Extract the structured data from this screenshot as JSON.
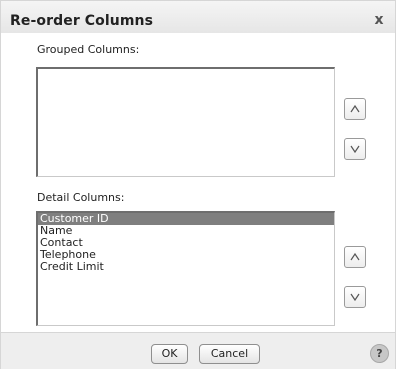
{
  "dialog": {
    "title": "Re-order Columns",
    "close_glyph": "x"
  },
  "grouped": {
    "label": "Grouped Columns:",
    "items": [],
    "up_icon": "chevron-up-icon",
    "down_icon": "chevron-down-icon"
  },
  "detail": {
    "label": "Detail Columns:",
    "items": [
      "Customer ID",
      "Name",
      "Contact",
      "Telephone",
      "Credit Limit"
    ],
    "selected": "Customer ID",
    "up_icon": "chevron-up-icon",
    "down_icon": "chevron-down-icon"
  },
  "footer": {
    "ok_label": "OK",
    "cancel_label": "Cancel",
    "help_glyph": "?"
  },
  "colors": {
    "selected_row": "#7f7f7f",
    "footer_bg": "#eeeeee"
  }
}
